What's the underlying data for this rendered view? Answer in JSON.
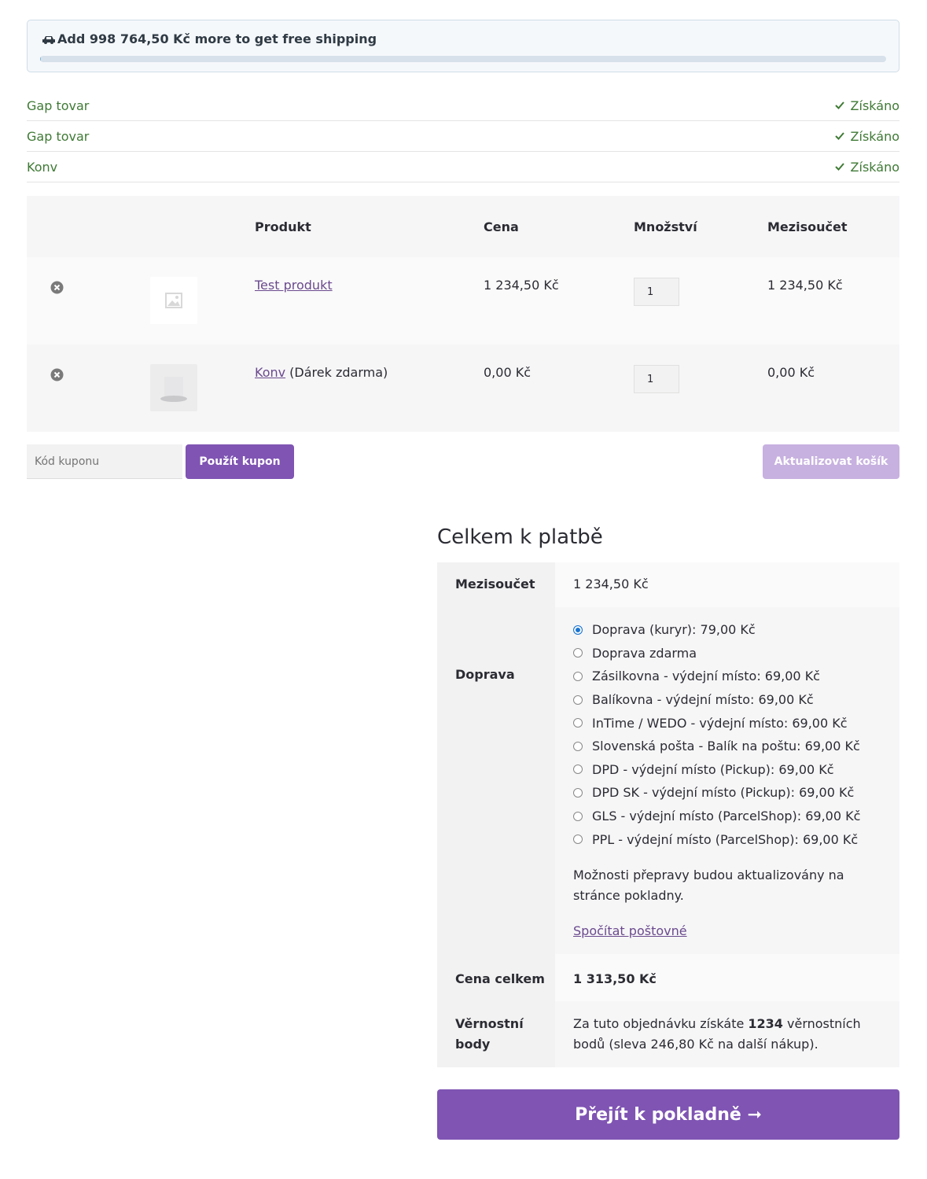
{
  "shipping_notice": {
    "text": "Add 998 764,50 Kč more to get free shipping",
    "icon": "car-icon",
    "progress_fraction": 0.0012
  },
  "gifts": [
    {
      "name": "Gap tovar",
      "status": "Získáno"
    },
    {
      "name": "Gap tovar",
      "status": "Získáno"
    },
    {
      "name": "Konv",
      "status": "Získáno"
    }
  ],
  "cart": {
    "headers": {
      "product": "Produkt",
      "price": "Cena",
      "quantity": "Množství",
      "subtotal": "Mezisoučet"
    },
    "items": [
      {
        "name": "Test produkt",
        "note": "",
        "price": "1 234,50 Kč",
        "qty": "1",
        "subtotal": "1 234,50 Kč"
      },
      {
        "name": "Konv",
        "note": " (Dárek zdarma)",
        "price": "0,00 Kč",
        "qty": "1",
        "subtotal": "0,00 Kč"
      }
    ]
  },
  "coupon": {
    "placeholder": "Kód kuponu",
    "apply_label": "Použít kupon",
    "update_label": "Aktualizovat košík"
  },
  "totals": {
    "title": "Celkem k platbě",
    "subtotal_label": "Mezisoučet",
    "subtotal_value": "1 234,50 Kč",
    "shipping_label": "Doprava",
    "shipping_options": [
      {
        "label": "Doprava (kuryr): 79,00 Kč",
        "selected": true
      },
      {
        "label": "Doprava zdarma",
        "selected": false
      },
      {
        "label": "Zásilkovna - výdejní místo: 69,00 Kč",
        "selected": false
      },
      {
        "label": "Balíkovna - výdejní místo: 69,00 Kč",
        "selected": false
      },
      {
        "label": "InTime / WEDO - výdejní místo: 69,00 Kč",
        "selected": false
      },
      {
        "label": "Slovenská pošta - Balík na poštu: 69,00 Kč",
        "selected": false
      },
      {
        "label": "DPD - výdejní místo (Pickup): 69,00 Kč",
        "selected": false
      },
      {
        "label": "DPD SK - výdejní místo (Pickup): 69,00 Kč",
        "selected": false
      },
      {
        "label": "GLS - výdejní místo (ParcelShop): 69,00 Kč",
        "selected": false
      },
      {
        "label": "PPL - výdejní místo (ParcelShop): 69,00 Kč",
        "selected": false
      }
    ],
    "shipping_note": "Možnosti přepravy budou aktualizovány na stránce pokladny.",
    "calc_link": "Spočítat poštovné",
    "total_label": "Cena celkem",
    "total_value": "1 313,50 Kč",
    "loyalty_label": "Věrnostní body",
    "loyalty_prefix": "Za tuto objednávku získáte ",
    "loyalty_points": "1234",
    "loyalty_suffix": " věrnostních bodů (sleva 246,80 Kč na další nákup)."
  },
  "checkout_label": "Přejít k pokladně ➞",
  "colors": {
    "accent": "#7f54b3",
    "accent_light": "#c7b1e0",
    "gift_green": "#3f7a35",
    "link": "#6b4a8e"
  }
}
